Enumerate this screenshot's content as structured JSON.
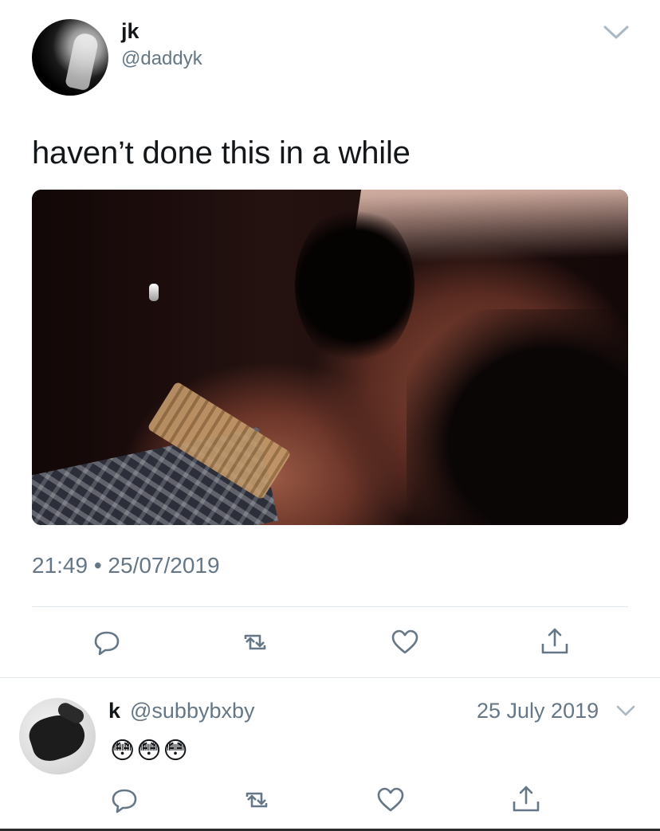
{
  "tweet": {
    "display_name": "jk",
    "handle": "@daddyk",
    "text": "haven’t done this in a while",
    "timestamp": "21:49 • 25/07/2019"
  },
  "reply": {
    "display_name": "k",
    "handle": "@subbybxby",
    "date": "25 July 2019",
    "text": "😳😳😳"
  },
  "icons": {
    "reply": "reply-icon",
    "retweet": "retweet-icon",
    "like": "heart-icon",
    "share": "share-icon",
    "caret": "chevron-down-icon"
  },
  "colors": {
    "primary_text": "#14171a",
    "secondary_text": "#657786",
    "divider": "#e1e8ed",
    "icon_gray": "#657786"
  }
}
